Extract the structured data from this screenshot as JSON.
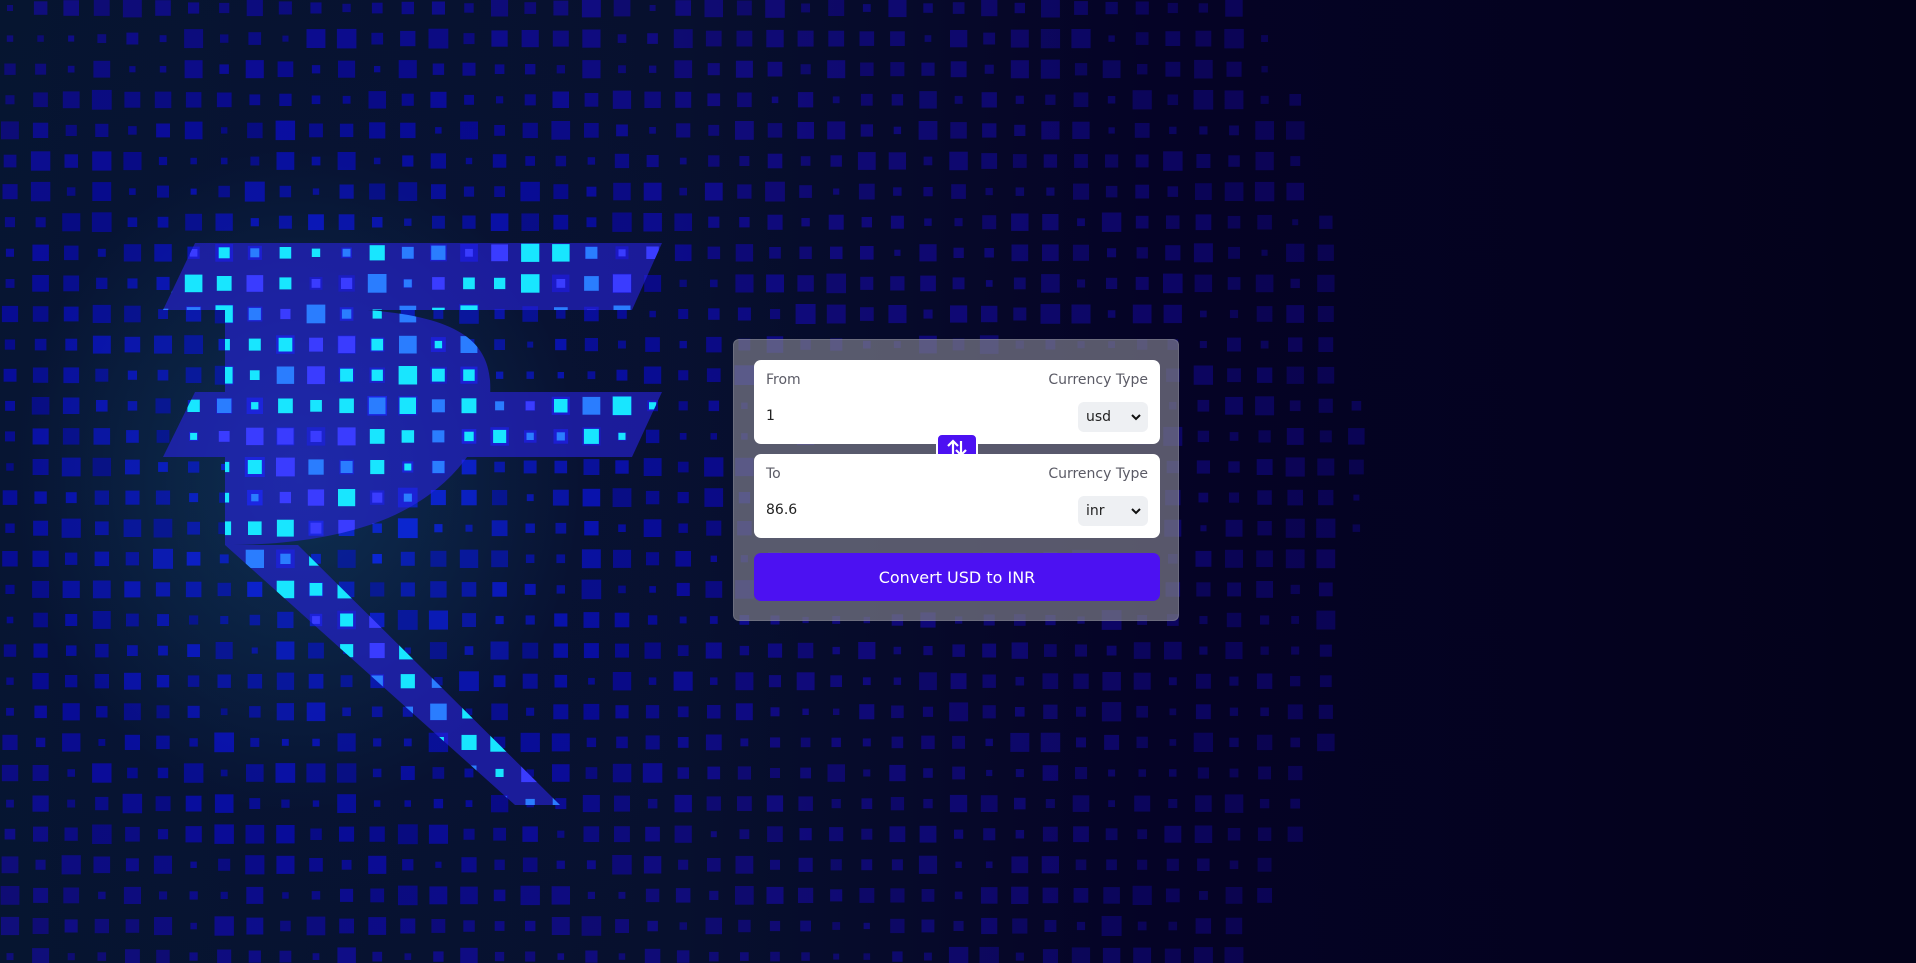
{
  "converter": {
    "from": {
      "label": "From",
      "currency_type_label": "Currency Type",
      "amount": "1",
      "currency": "usd"
    },
    "to": {
      "label": "To",
      "currency_type_label": "Currency Type",
      "amount": "86.6",
      "currency": "inr"
    },
    "swap_icon": "swap-vertical-arrows",
    "convert_button_label": "Convert USD to INR"
  },
  "colors": {
    "accent": "#4c11f2",
    "background": "#04021a",
    "card": "#78788a"
  },
  "background_icon": "rupee-symbol"
}
